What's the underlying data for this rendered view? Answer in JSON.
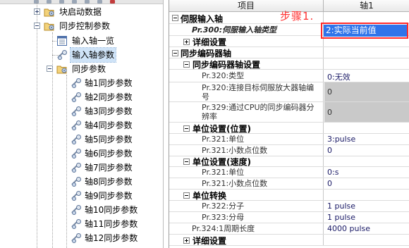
{
  "tree": {
    "items": [
      {
        "label": "块启动数据",
        "expander": "plus"
      },
      {
        "label": "同步控制参数",
        "expander": "minus"
      },
      {
        "label": "输入轴一览",
        "expander": ""
      },
      {
        "label": "输入轴参数",
        "expander": ""
      },
      {
        "label": "同步参数",
        "expander": "minus"
      },
      {
        "label": "轴1同步参数",
        "expander": ""
      },
      {
        "label": "轴2同步参数",
        "expander": ""
      },
      {
        "label": "轴3同步参数",
        "expander": ""
      },
      {
        "label": "轴4同步参数",
        "expander": ""
      },
      {
        "label": "轴5同步参数",
        "expander": ""
      },
      {
        "label": "轴6同步参数",
        "expander": ""
      },
      {
        "label": "轴7同步参数",
        "expander": ""
      },
      {
        "label": "轴8同步参数",
        "expander": ""
      },
      {
        "label": "轴9同步参数",
        "expander": ""
      },
      {
        "label": "轴10同步参数",
        "expander": ""
      },
      {
        "label": "轴11同步参数",
        "expander": ""
      },
      {
        "label": "轴12同步参数",
        "expander": ""
      }
    ]
  },
  "grid": {
    "header": {
      "item": "项目",
      "axis": "轴1"
    },
    "rows": [
      {
        "name": "伺服输入轴",
        "value": ""
      },
      {
        "name": "Pr.300:伺服输入轴类型",
        "value": "2:实际当前值"
      },
      {
        "name": "详细设置",
        "value": ""
      },
      {
        "name": "同步编码器轴",
        "value": ""
      },
      {
        "name": "同步编码器轴设置",
        "value": ""
      },
      {
        "name": "Pr.320:类型",
        "value": "0:无效"
      },
      {
        "name": "Pr.320:连接目标伺服放大器轴编号",
        "value": "0"
      },
      {
        "name": "Pr.329:通过CPU的同步编码器分辨率",
        "value": "0"
      },
      {
        "name": "单位设置(位置)",
        "value": ""
      },
      {
        "name": "Pr.321:单位",
        "value": "3:pulse"
      },
      {
        "name": "Pr.321:小数点位数",
        "value": "0"
      },
      {
        "name": "单位设置(速度)",
        "value": ""
      },
      {
        "name": "Pr.321:单位",
        "value": "0:s"
      },
      {
        "name": "Pr.321:小数点位数",
        "value": "0"
      },
      {
        "name": "单位转换",
        "value": ""
      },
      {
        "name": "Pr.322:分子",
        "value": "1 pulse"
      },
      {
        "name": "Pr.323:分母",
        "value": "1 pulse"
      },
      {
        "name": "Pr.324:1周期长度",
        "value": "4000 pulse"
      },
      {
        "name": "详细设置",
        "value": ""
      }
    ]
  },
  "annotation": {
    "text": "步骤1.",
    "color": "#ff3030"
  },
  "colors": {
    "selection": "#2f74ea",
    "disabled_cell": "#c9c9c9",
    "tree_selection": "#cfe3f7"
  },
  "icons": {
    "block-start-data": "folder-gear-icon",
    "sync-control-params": "folder-gear-icon",
    "input-axis-list": "list-window-icon",
    "input-axis-params": "gear-params-icon",
    "sync-params": "folder-gear-icon",
    "axis-sync-params": "gear-params-icon"
  }
}
